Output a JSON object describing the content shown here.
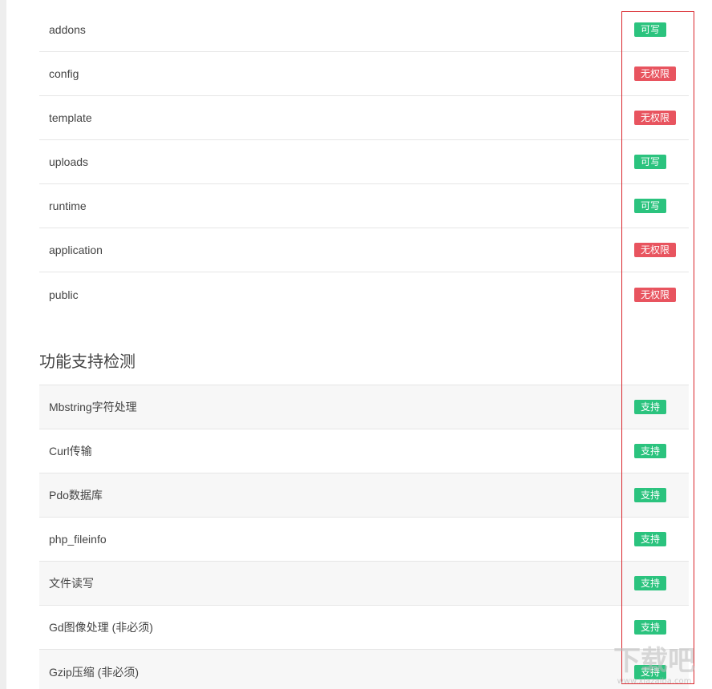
{
  "directory_check": {
    "rows": [
      {
        "name": "addons",
        "status": "可写",
        "state": "ok"
      },
      {
        "name": "config",
        "status": "无权限",
        "state": "deny"
      },
      {
        "name": "template",
        "status": "无权限",
        "state": "deny"
      },
      {
        "name": "uploads",
        "status": "可写",
        "state": "ok"
      },
      {
        "name": "runtime",
        "status": "可写",
        "state": "ok"
      },
      {
        "name": "application",
        "status": "无权限",
        "state": "deny"
      },
      {
        "name": "public",
        "status": "无权限",
        "state": "deny"
      }
    ]
  },
  "function_check": {
    "title": "功能支持检测",
    "rows": [
      {
        "name": "Mbstring字符处理",
        "status": "支持",
        "state": "ok"
      },
      {
        "name": "Curl传输",
        "status": "支持",
        "state": "ok"
      },
      {
        "name": "Pdo数据库",
        "status": "支持",
        "state": "ok"
      },
      {
        "name": "php_fileinfo",
        "status": "支持",
        "state": "ok"
      },
      {
        "name": "文件读写",
        "status": "支持",
        "state": "ok"
      },
      {
        "name": "Gd图像处理 (非必须)",
        "status": "支持",
        "state": "ok"
      },
      {
        "name": "Gzip压缩 (非必须)",
        "status": "支持",
        "state": "ok"
      }
    ]
  },
  "colors": {
    "ok_badge": "#2bc37e",
    "deny_badge": "#e8545f",
    "highlight_border": "#d9262c"
  },
  "watermark": {
    "text": "下载吧",
    "subtext": "www.xiazaiba.com"
  }
}
